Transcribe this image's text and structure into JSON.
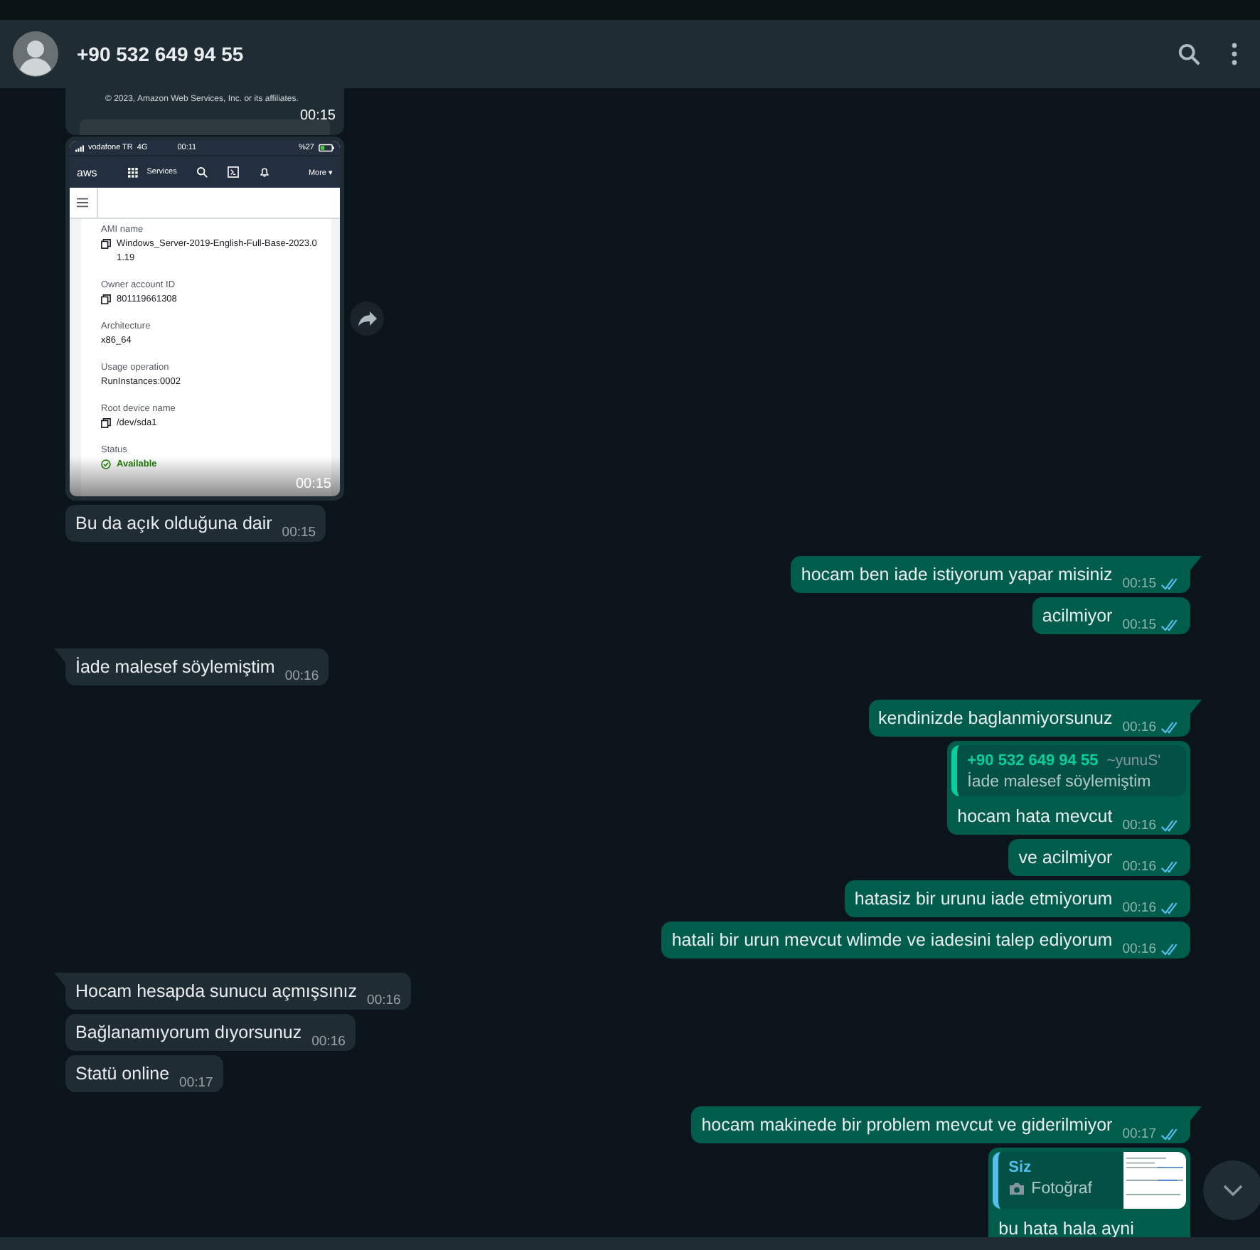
{
  "header": {
    "contact": "+90 532 649 94 55"
  },
  "messages": [
    {
      "kind": "image_crop",
      "outgoing": false,
      "tail": false,
      "footer_text": "© 2023, Amazon Web Services, Inc. or its affiliates.",
      "time": "00:15"
    },
    {
      "kind": "screenshot",
      "outgoing": false,
      "tail": false,
      "time": "00:15",
      "forward": true,
      "screenshot": {
        "carrier": "vodafone TR",
        "network": "4G",
        "clock": "00:11",
        "battery": "%27",
        "logo": "aws",
        "services": "Services",
        "more": "More ▾",
        "fields": [
          {
            "label": "AMI name",
            "value": "Windows_Server-2019-English-Full-Base-2023.01.19",
            "kind": "copy"
          },
          {
            "label": "Owner account ID",
            "value": "801119661308",
            "kind": "copy"
          },
          {
            "label": "Architecture",
            "value": "x86_64",
            "kind": "plain"
          },
          {
            "label": "Usage operation",
            "value": "RunInstances:0002",
            "kind": "plain"
          },
          {
            "label": "Root device name",
            "value": "/dev/sda1",
            "kind": "copy"
          },
          {
            "label": "Status",
            "value": "Available",
            "kind": "status"
          }
        ]
      }
    },
    {
      "kind": "text",
      "outgoing": false,
      "tail": false,
      "text": "Bu da açık olduğuna dair",
      "time": "00:15"
    },
    {
      "kind": "text",
      "outgoing": true,
      "tail": true,
      "text": "hocam ben iade istiyorum yapar misiniz",
      "time": "00:15",
      "read": true
    },
    {
      "kind": "text",
      "outgoing": true,
      "tail": false,
      "text": "acilmiyor",
      "time": "00:15",
      "read": true
    },
    {
      "kind": "text",
      "outgoing": false,
      "tail": true,
      "text": "İade malesef söylemiştim",
      "time": "00:16"
    },
    {
      "kind": "text",
      "outgoing": true,
      "tail": true,
      "text": "kendinizde baglanmiyorsunuz",
      "time": "00:16",
      "read": true
    },
    {
      "kind": "reply",
      "outgoing": true,
      "tail": false,
      "text": "hocam hata mevcut",
      "time": "00:16",
      "read": true,
      "quote": {
        "kind": "text",
        "author": "+90 532 649 94 55",
        "author_note": "~yunuS'",
        "text": "İade malesef söylemiştim",
        "color": "#06cf9c"
      }
    },
    {
      "kind": "text",
      "outgoing": true,
      "tail": false,
      "text": "ve acilmiyor",
      "time": "00:16",
      "read": true
    },
    {
      "kind": "text",
      "outgoing": true,
      "tail": false,
      "text": "hatasiz bir urunu iade etmiyorum",
      "time": "00:16",
      "read": true
    },
    {
      "kind": "text",
      "outgoing": true,
      "tail": false,
      "text": "hatali bir urun mevcut wlimde ve iadesini talep ediyorum",
      "time": "00:16",
      "read": true
    },
    {
      "kind": "text",
      "outgoing": false,
      "tail": true,
      "text": "Hocam hesapda sunucu açmışsınız",
      "time": "00:16"
    },
    {
      "kind": "text",
      "outgoing": false,
      "tail": false,
      "text": "Bağlanamıyorum dıyorsunuz",
      "time": "00:16"
    },
    {
      "kind": "text",
      "outgoing": false,
      "tail": false,
      "text": "Statü online",
      "time": "00:17"
    },
    {
      "kind": "text",
      "outgoing": true,
      "tail": true,
      "text": "hocam makinede bir problem mevcut ve giderilmiyor",
      "time": "00:17",
      "read": true
    },
    {
      "kind": "reply",
      "outgoing": true,
      "tail": false,
      "text": "bu hata hala ayni",
      "quote": {
        "kind": "photo",
        "author": "Siz",
        "text": "Fotoğraf",
        "color": "#53bdeb"
      }
    }
  ]
}
